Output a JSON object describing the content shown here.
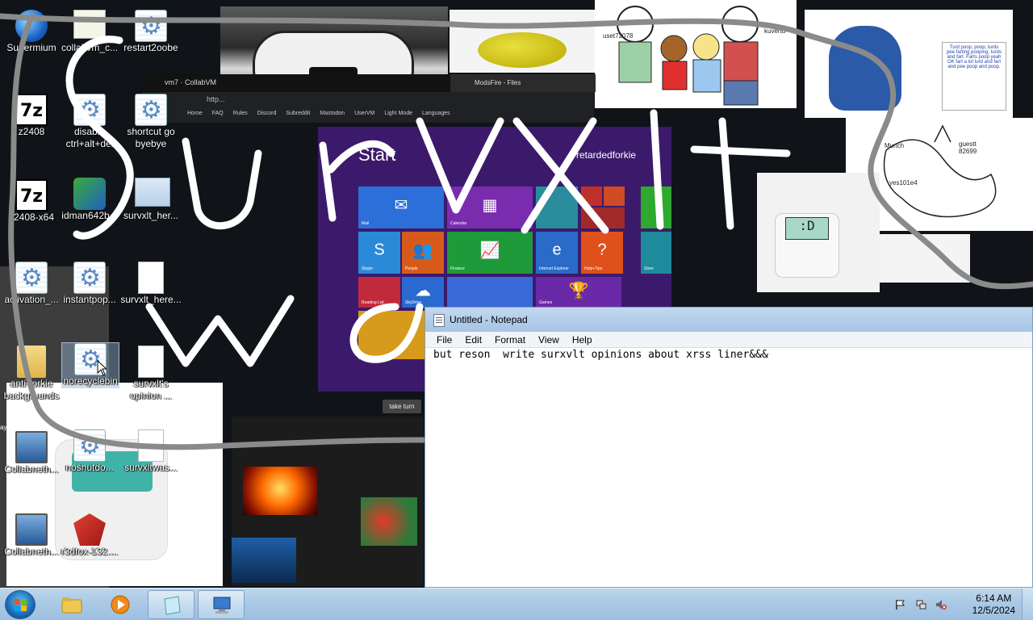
{
  "desktop": {
    "icons": [
      {
        "label": "Supermium",
        "kind": "globe"
      },
      {
        "label": "collabvm_c...",
        "kind": "cert"
      },
      {
        "label": "restart2oobe",
        "kind": "gear"
      },
      {
        "label": "z2408",
        "kind": "7z"
      },
      {
        "label": "disable ctrl+alt+del",
        "kind": "gear"
      },
      {
        "label": "shortcut go byebye",
        "kind": "gear"
      },
      {
        "label": "z2408-x64",
        "kind": "7z"
      },
      {
        "label": "idman642b...",
        "kind": "installer"
      },
      {
        "label": "survxlt_her...",
        "kind": "winstack"
      },
      {
        "label": "activation_...",
        "kind": "gear"
      },
      {
        "label": "instantpop...",
        "kind": "gear"
      },
      {
        "label": "survxlt_here...",
        "kind": "doc"
      },
      {
        "label": "anti-forkie backgrounds",
        "kind": "folder"
      },
      {
        "label": "norecyclebin",
        "kind": "gear"
      },
      {
        "label": "survxlt's opinion ...",
        "kind": "doc"
      },
      {
        "label": "Collabneth...",
        "kind": "pc"
      },
      {
        "label": "noshutdo...",
        "kind": "gear"
      },
      {
        "label": "survxltwas...",
        "kind": "doc"
      },
      {
        "label": "Collabneth...",
        "kind": "pc"
      },
      {
        "label": "r3dfox-132....",
        "kind": "ff"
      }
    ]
  },
  "wallpaper": {
    "browser_tab": "vm7 · CollabVM",
    "browser_address": "http...",
    "browser_nav": [
      "Home",
      "FAQ",
      "Rules",
      "Discord",
      "Subreddit",
      "Mastodon",
      "UserVM",
      "Light Mode",
      "Languages"
    ],
    "modsfire_tab": "ModsFire - Files",
    "take_turn": "take turn",
    "start_title": "Start",
    "start_user": "retardedforkie",
    "tiles": [
      "Mail",
      "Calendar",
      "Skype",
      "People",
      "Finance",
      "Internet Explorer",
      "Help+Tips",
      "Reading List",
      "SkyDrive",
      "Games",
      "Store"
    ],
    "cat_note": "Turd poop, poop, turds pee farting pooping, turds and fart. Farts poop yeah OK fart a lot turd and fart and pee poop and poop.",
    "sketch_text": [
      "guestt 82699",
      "yes101e4",
      "Munch"
    ],
    "robot_face": ":D",
    "comic_user": "uset72078",
    "comic_user2": "kuvertu",
    "gamer_text": "aying a game"
  },
  "scribble_text": "survxlt was",
  "notepad": {
    "title": "Untitled - Notepad",
    "menu": [
      "File",
      "Edit",
      "Format",
      "View",
      "Help"
    ],
    "content": "but reson  write surxvlt opinions about xrss liner&&&"
  },
  "taskbar": {
    "time": "6:14 AM",
    "date": "12/5/2024",
    "buttons": [
      "explorer",
      "media-player",
      "notepad",
      "network-computer"
    ]
  },
  "colors": {
    "taskbar": "#a9c8e4",
    "start_screen": "#3b1a6b",
    "notepad_title": "#c2d8ef"
  }
}
